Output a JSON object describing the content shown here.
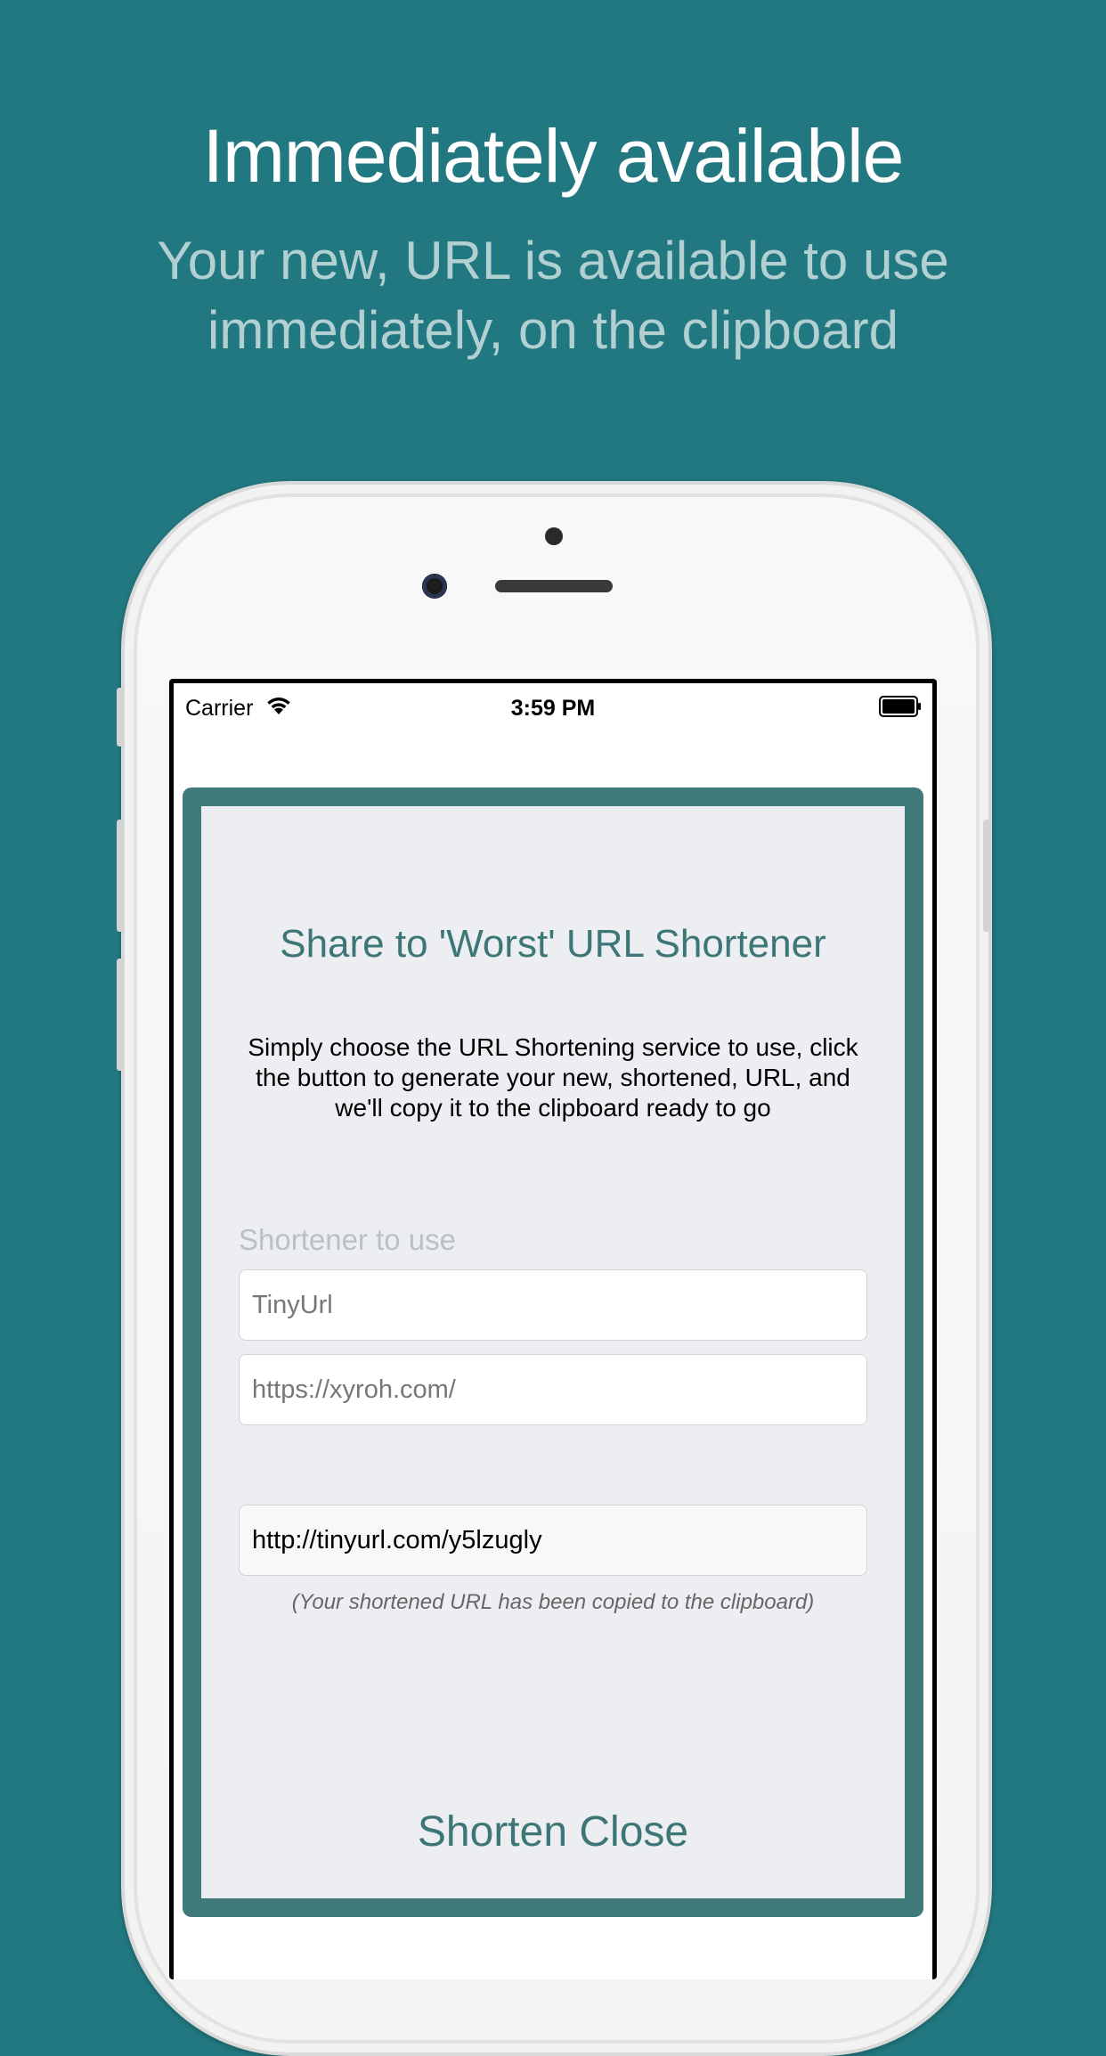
{
  "promo": {
    "headline": "Immediately available",
    "subhead": "Your new, URL is available to use immediately, on the clipboard"
  },
  "status_bar": {
    "carrier": "Carrier",
    "time": "3:59 PM",
    "icons": [
      "wifi-icon",
      "battery-icon"
    ]
  },
  "dialog": {
    "title": "Share to 'Worst' URL Shortener",
    "description": "Simply choose the URL Shortening service to use, click the button to generate your new, shortened, URL, and we'll copy it to the clipboard ready to go",
    "shortener_label": "Shortener to use",
    "shortener_value": "TinyUrl",
    "url_value": "https://xyroh.com/",
    "result_value": "http://tinyurl.com/y5lzugly",
    "copied_note": "(Your shortened URL has been copied to the clipboard)",
    "shorten_label": "Shorten",
    "close_label": "Close"
  },
  "colors": {
    "background": "#227880",
    "accent": "#3c7676",
    "dialog_frame": "#407a7a",
    "dialog_bg": "#eceef2"
  }
}
